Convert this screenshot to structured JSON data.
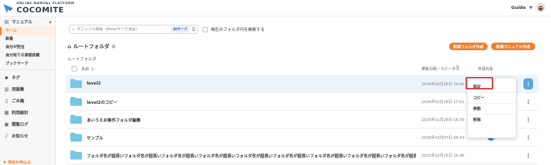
{
  "app": {
    "logo_tagline": "ONLINE MANUAL PLATFORM",
    "logo_name": "COCOMITE",
    "user_name": "Guide",
    "accent": "#f07f2a"
  },
  "sidebar": {
    "manual_label": "マニュアル",
    "manual_items": [
      "ホーム",
      "新着",
      "自分が担当",
      "自分宛ての承認依頼",
      "ブックマーク"
    ],
    "sections": [
      "タグ",
      "用語集",
      "ごみ箱",
      "利用統計",
      "閲覧ログ",
      "お知らせ"
    ],
    "bottom_label": "契約お申込み"
  },
  "search": {
    "placeholder": "マニュアル検索（Enterキーで決定）",
    "ai_mode_label": "AIモード",
    "scope_label": "現在のフォルダ内を検索する"
  },
  "header": {
    "title": "ルートフォルダ",
    "new_folder_button": "新規フォルダ作成",
    "new_manual_button": "新規マニュアル作成",
    "breadcrumb": "ルートフォルダ"
  },
  "table": {
    "col_name": "名前",
    "col_updated": "更新日時／ステータス",
    "col_share": "外部共有",
    "rows": [
      {
        "name": "level2",
        "updated": "2026年02月26日 10:42"
      },
      {
        "name": "level2のコピー",
        "updated": "2026年02月26日 17:01"
      },
      {
        "name": "あいうえお無作フォルダ編集",
        "updated": "2025年11月28日 16:39"
      },
      {
        "name": "サンプル",
        "updated": "2026年02月07日 08:43"
      },
      {
        "name": "フォルダ名が超長いフォルダ名が超長いフォルダ名が超長いフォルダ名が超長いフォルダ名が超長いフォルダ名が超長いフォルダ名が超長いフォルダ名が超長いフォルダ名が超長いフォルダ名が超長いフォルダ名が超長いフォルダ名が超長い...",
        "updated": "2025年12月25日 15:46"
      }
    ]
  },
  "context_menu": {
    "items": [
      "設定",
      "コピー",
      "移動",
      "削除"
    ]
  }
}
